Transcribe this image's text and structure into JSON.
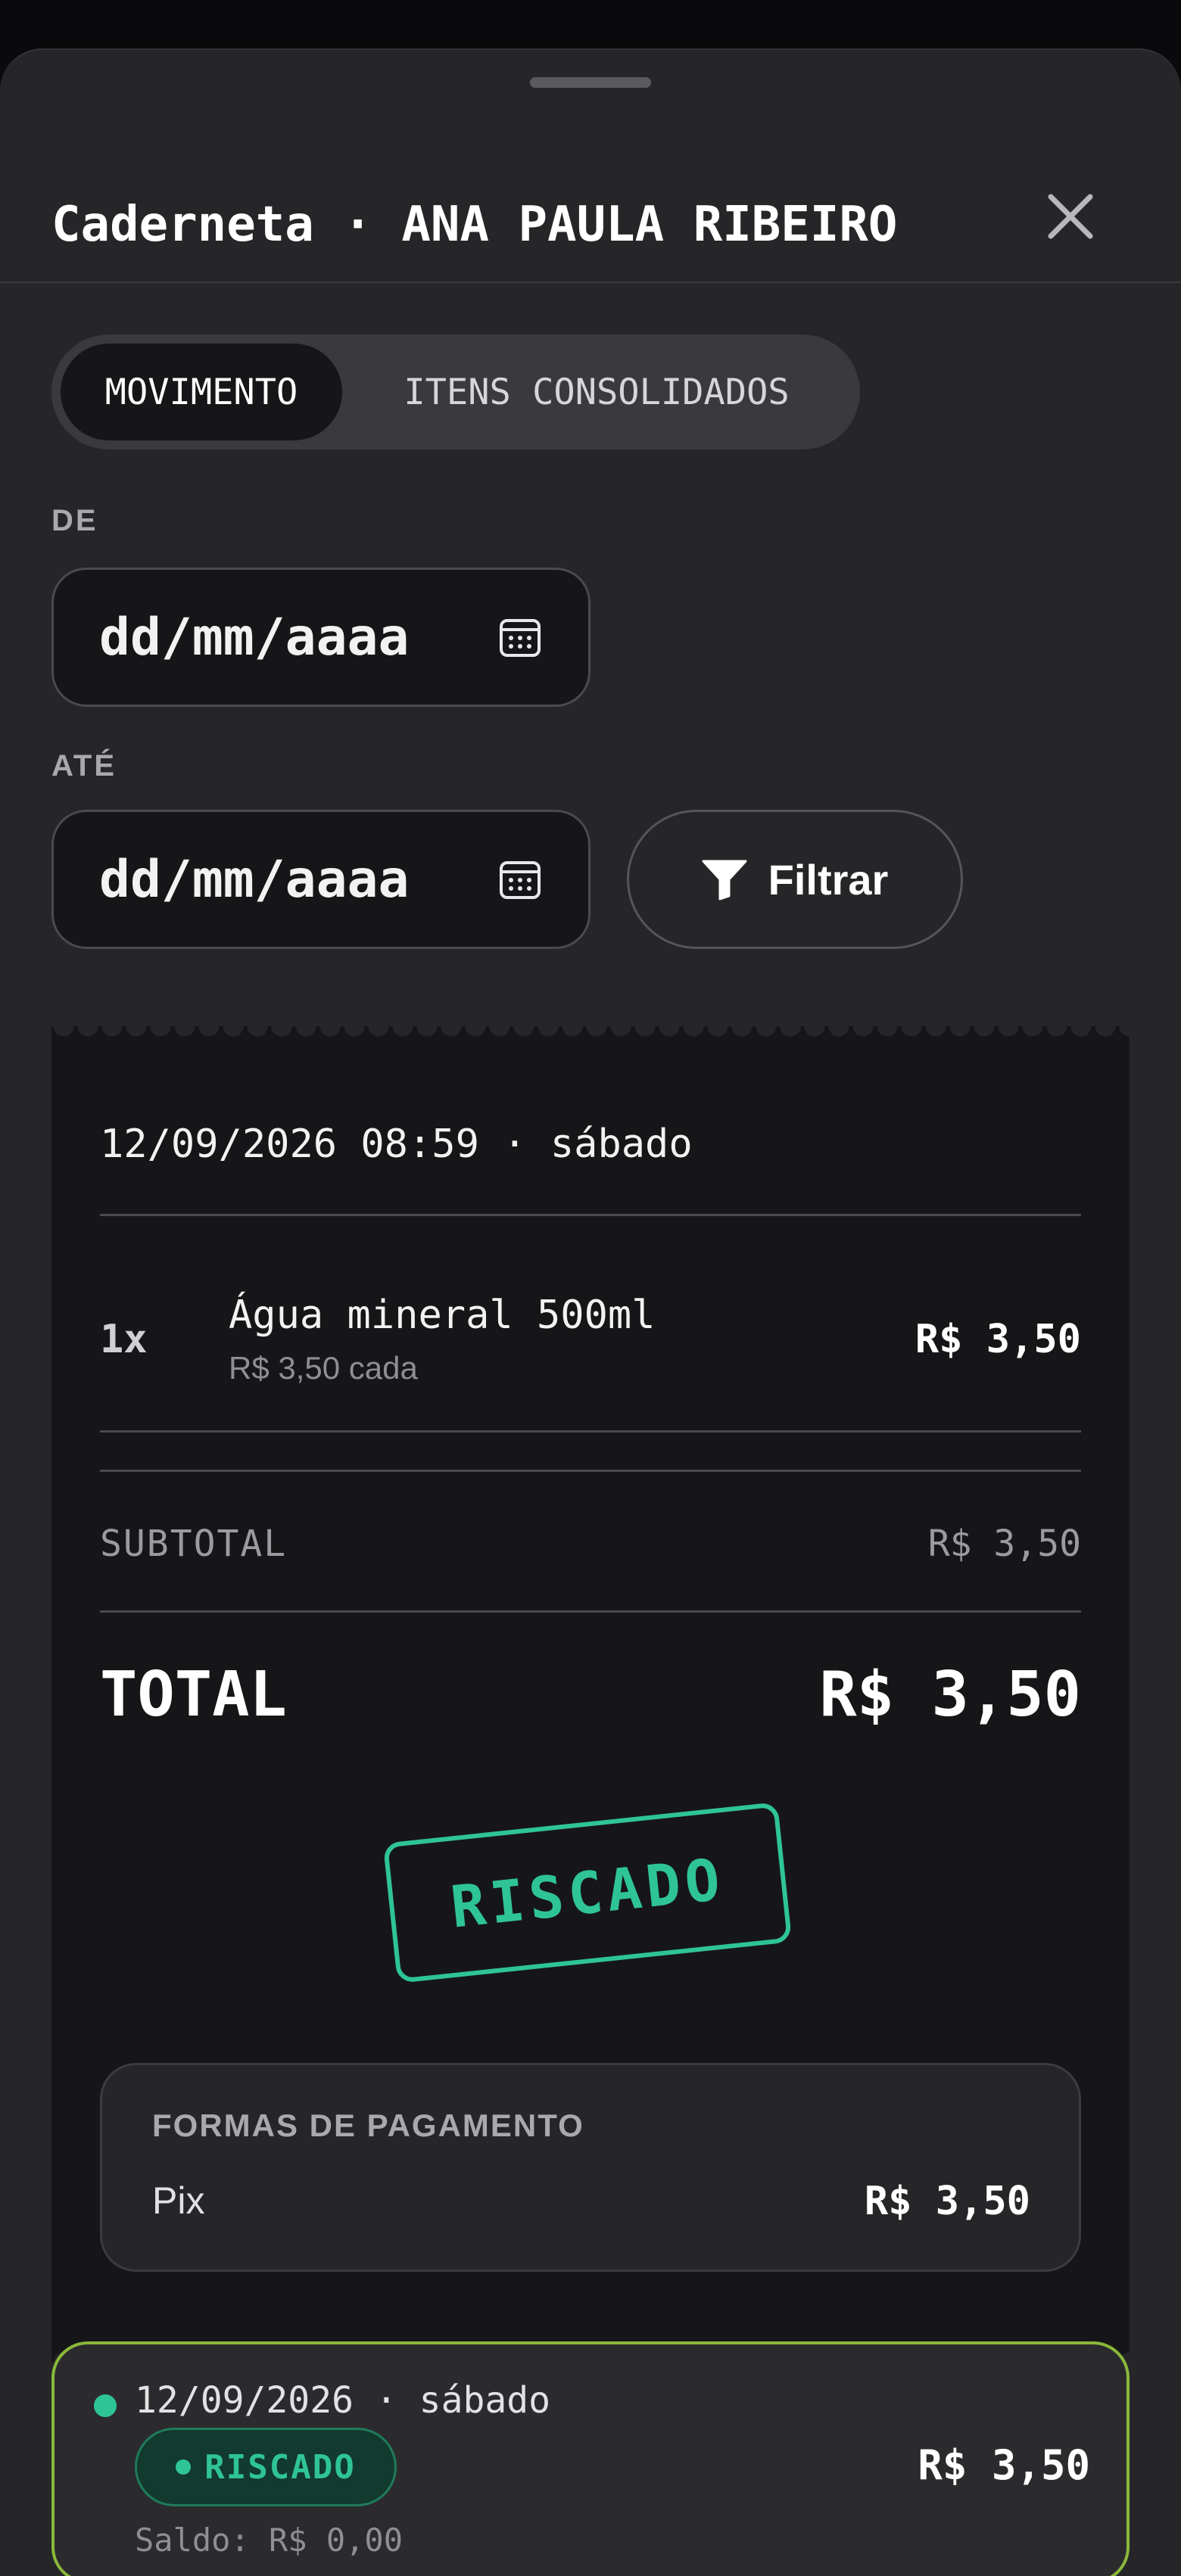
{
  "sheet": {
    "title": "Caderneta · ANA PAULA RIBEIRO"
  },
  "tabs": [
    {
      "label": "MOVIMENTO",
      "active": true
    },
    {
      "label": "ITENS CONSOLIDADOS",
      "active": false
    }
  ],
  "filters": {
    "from_label": "DE",
    "from_placeholder": "dd/mm/aaaa",
    "to_label": "ATÉ",
    "to_placeholder": "dd/mm/aaaa",
    "filter_button": "Filtrar",
    "filter_icon": "filter-icon",
    "calendar_icon": "calendar-icon"
  },
  "receipt": {
    "datetime": "12/09/2026 08:59 · sábado",
    "items": [
      {
        "qty": "1x",
        "name": "Água mineral 500ml",
        "unit_price": "R$ 3,50 cada",
        "price": "R$ 3,50"
      }
    ],
    "subtotal_label": "SUBTOTAL",
    "subtotal_value": "R$ 3,50",
    "total_label": "TOTAL",
    "total_value": "R$ 3,50",
    "stamp": "RISCADO",
    "payments": {
      "title": "FORMAS DE PAGAMENTO",
      "method": "Pix",
      "value": "R$ 3,50"
    }
  },
  "entries": [
    {
      "date": "12/09/2026 · sábado",
      "status": "RISCADO",
      "amount": "R$ 3,50",
      "balance": "Saldo: R$ 0,00"
    }
  ],
  "colors": {
    "background": "#262629",
    "receipt": "#161618",
    "accent_green": "#2fc495",
    "card_border": "#8ab83a"
  }
}
